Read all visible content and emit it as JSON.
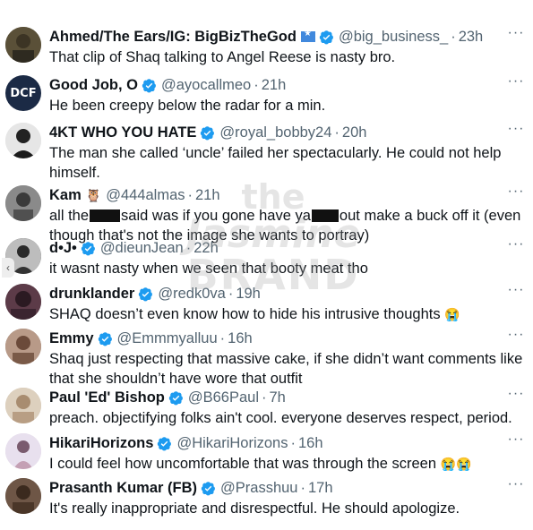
{
  "icons": {
    "verified": "verified-badge-icon",
    "more": "more-options-icon",
    "flag": "somalia-flag-icon",
    "owl": "owl-emoji-icon",
    "crying": "loudly-crying-face-emoji"
  },
  "colors": {
    "verified": "#1d9bf0",
    "handle": "#536471",
    "text": "#0f1419"
  },
  "watermark": {
    "line1": "the",
    "line2": "Jasmine",
    "line3": "BRAND"
  },
  "tweets": [
    {
      "name": "Ahmed/The Ears/IG: BigBizTheGod",
      "handle": "@big_business_",
      "time": "23h",
      "text": "That clip of Shaq talking to Angel Reese is nasty bro.",
      "verified": true,
      "avatar_color": "#5a5038"
    },
    {
      "name": "Good Job, O",
      "handle": "@ayocallmeo",
      "time": "21h",
      "text": "He been creepy below the radar for a min.",
      "verified": true,
      "avatar_color": "#1b2a45",
      "avatar_text": "DCF"
    },
    {
      "name": "4KT WHO YOU HATE",
      "handle": "@royal_bobby24",
      "time": "20h",
      "text": "The man she called ‘uncle’ failed her spectacularly. He could not help himself.",
      "verified": true,
      "avatar_color": "#2b2b2b"
    },
    {
      "name": "Kam",
      "handle": "@444almas",
      "time": "21h",
      "text_a": "all the",
      "text_b": "said was if you gone have ya",
      "text_c": "out make a buck off it (even though that's not the image she wants to portray)",
      "verified": false,
      "avatar_color": "#6d6d6d"
    },
    {
      "name": "d•J•",
      "handle": "@dieunJean",
      "time": "22h",
      "text": "it wasnt nasty when we seen that booty meat tho",
      "verified": true,
      "avatar_color": "#3a3a3a"
    },
    {
      "name": "drunklander",
      "handle": "@redk0va",
      "time": "19h",
      "text": "SHAQ doesn’t even know how to hide his intrusive thoughts",
      "verified": true,
      "avatar_color": "#4a2e3a"
    },
    {
      "name": "Emmy",
      "handle": "@Emmmyalluu",
      "time": "16h",
      "text": "Shaq just respecting that massive cake, if she didn’t want comments like that she shouldn’t have wore that outfit",
      "verified": true,
      "avatar_color": "#8a6a5a"
    },
    {
      "name": "Paul 'Ed' Bishop",
      "handle": "@B66Paul",
      "time": "7h",
      "text": "preach. objectifying folks ain't cool. everyone deserves respect, period.",
      "verified": true,
      "avatar_color": "#c9b8a2"
    },
    {
      "name": "HikariHorizons",
      "handle": "@HikariHorizons",
      "time": "16h",
      "text": "I could feel how uncomfortable that was through the screen",
      "verified": true,
      "avatar_color": "#d9cfe0"
    },
    {
      "name": "Prasanth Kumar (FB)",
      "handle": "@Prasshuu",
      "time": "17h",
      "text": "It's really inappropriate and disrespectful. He should apologize.",
      "verified": true,
      "avatar_color": "#5b4636"
    }
  ]
}
